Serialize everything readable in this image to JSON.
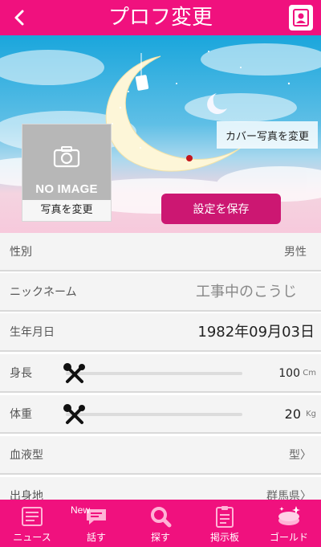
{
  "header": {
    "title": "プロフ変更"
  },
  "cover": {
    "change_label": "カバー写真を変更"
  },
  "photo": {
    "no_image": "NO IMAGE",
    "change_label": "写真を変更"
  },
  "save_label": "設定を保存",
  "fields": {
    "gender": {
      "label": "性別",
      "value": "男性"
    },
    "nickname": {
      "label": "ニックネーム",
      "placeholder": "工事中のこうじ"
    },
    "birthday": {
      "label": "生年月日",
      "value": "1982年09月03日"
    },
    "height": {
      "label": "身長",
      "value": "100",
      "unit": "Cm"
    },
    "weight": {
      "label": "体重",
      "value": "20",
      "unit": "Kg"
    },
    "blood": {
      "label": "血液型",
      "value": "型〉"
    },
    "hometown": {
      "label": "出身地",
      "value": "群馬県〉"
    }
  },
  "nav": [
    {
      "label": "ニュース",
      "icon": "news-icon"
    },
    {
      "label": "話す",
      "icon": "chat-icon",
      "badge": "New"
    },
    {
      "label": "探す",
      "icon": "search-icon"
    },
    {
      "label": "掲示板",
      "icon": "board-icon"
    },
    {
      "label": "ゴールド",
      "icon": "gold-icon"
    }
  ],
  "colors": {
    "accent": "#f0117e",
    "save": "#cc1772"
  }
}
